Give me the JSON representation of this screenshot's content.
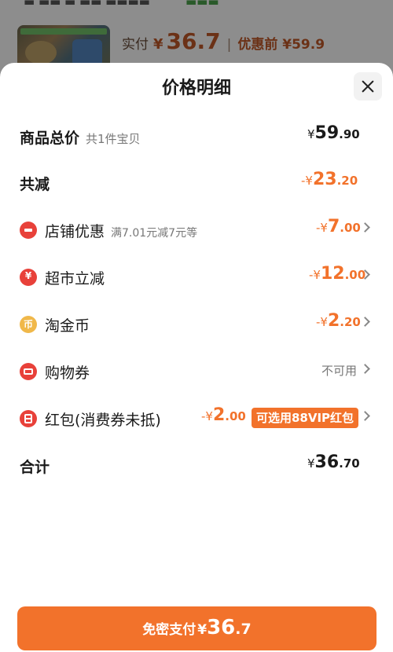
{
  "background": {
    "actual_pay_label": "实付",
    "currency": "¥",
    "actual_pay_value": "36.7",
    "before_discount": "优惠前 ¥59.9"
  },
  "sheet": {
    "title": "价格明细",
    "close_icon": "close-icon"
  },
  "rows": {
    "total": {
      "label": "商品总价",
      "sub": "共1件宝贝",
      "sym": "¥",
      "int": "59",
      "dec": ".90"
    },
    "reduction": {
      "label": "共减",
      "sym": "-¥",
      "int": "23",
      "dec": ".20"
    },
    "shop_discount": {
      "icon": "shop-discount-icon",
      "label": "店铺优惠",
      "sub": "满7.01元减7元等",
      "sym": "-¥",
      "int": "7",
      "dec": ".00"
    },
    "supermarket": {
      "icon": "yuan-coin-icon",
      "glyph": "¥",
      "label": "超市立减",
      "sym": "-¥",
      "int": "12",
      "dec": ".00"
    },
    "gold_coin": {
      "icon": "gold-coin-icon",
      "glyph": "币",
      "label": "淘金币",
      "sym": "-¥",
      "int": "2",
      "dec": ".20"
    },
    "coupon": {
      "icon": "ticket-icon",
      "label": "购物券",
      "status": "不可用"
    },
    "red_packet": {
      "icon": "red-packet-icon",
      "label": "红包(消费券未抵)",
      "sym": "-¥",
      "int": "2",
      "dec": ".00",
      "badge": "可选用88VIP红包"
    },
    "sum": {
      "label": "合计",
      "sym": "¥",
      "int": "36",
      "dec": ".70"
    }
  },
  "pay_button": {
    "label": "免密支付",
    "sym": "¥",
    "int": "36",
    "dec": ".7"
  },
  "colors": {
    "accent": "#f2722b",
    "icon_red": "#e8413a",
    "icon_gold": "#f0b84a"
  }
}
